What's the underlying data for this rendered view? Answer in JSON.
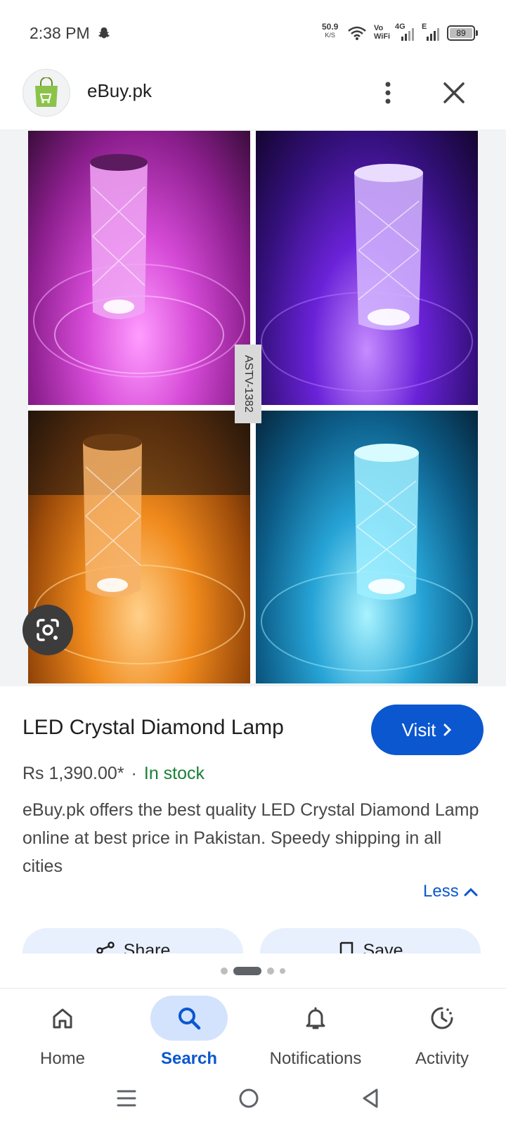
{
  "status_bar": {
    "time": "2:38 PM",
    "net_speed_value": "50.9",
    "net_speed_unit": "K/S",
    "vowifi_line1": "Vo",
    "vowifi_line2": "WiFi",
    "network_type_1": "4G",
    "network_type_2": "E",
    "battery_level": "89",
    "icons": [
      "snapchat-icon",
      "wifi-icon",
      "signal-icon",
      "battery-icon"
    ]
  },
  "header": {
    "site_name": "eBuy.pk",
    "logo_icon": "shopping-bag-icon",
    "more_icon": "more-vert-icon",
    "close_icon": "close-icon"
  },
  "image": {
    "watermark_label": "ASTV-1382",
    "lens_icon": "google-lens-icon",
    "quadrant_colors": [
      "#d54ad6",
      "#6a22d8",
      "#f08a1c",
      "#27a4d6"
    ]
  },
  "product": {
    "title": "LED Crystal Diamond Lamp",
    "visit_label": "Visit",
    "price": "Rs 1,390.00*",
    "separator": "·",
    "stock_status": "In stock",
    "description": "eBuy.pk offers the best quality LED Crystal Diamond Lamp online at best price in Pakistan. Speedy shipping in all cities",
    "less_label": "Less"
  },
  "actions": {
    "share_label": "Share",
    "save_label": "Save"
  },
  "pager": {
    "count": 4,
    "active_index": 1
  },
  "bottom_nav": {
    "items": [
      {
        "label": "Home",
        "icon": "home-icon"
      },
      {
        "label": "Search",
        "icon": "search-icon",
        "active": true
      },
      {
        "label": "Notifications",
        "icon": "bell-icon"
      },
      {
        "label": "Activity",
        "icon": "activity-icon"
      }
    ]
  },
  "colors": {
    "accent": "#0b57d0",
    "in_stock": "#188038",
    "active_nav_bg": "#d3e3fd"
  }
}
